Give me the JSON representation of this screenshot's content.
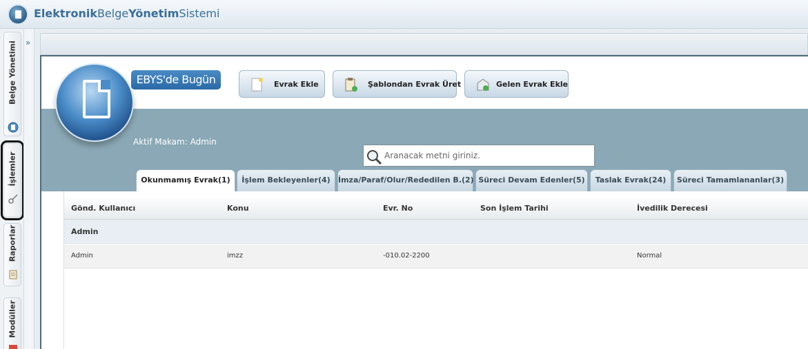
{
  "app": {
    "title_part1": "Elektronik",
    "title_part2": "Belge",
    "title_part3": "Yönetim",
    "title_part4": "Sistemi"
  },
  "left_tabs": [
    {
      "label": "Belge Yönetimi",
      "icon": "document-icon"
    },
    {
      "label": "İşlemler",
      "icon": "key-icon"
    },
    {
      "label": "Raporlar",
      "icon": "report-icon"
    },
    {
      "label": "Modüller",
      "icon": "module-icon"
    }
  ],
  "hero": {
    "pill_label": "EBYS'de Bugün",
    "aktif_makam": "Aktif Makam: Admin"
  },
  "actions": [
    {
      "label": "Evrak Ekle",
      "icon": "new-document-icon"
    },
    {
      "label": "Şablondan Evrak Üret",
      "icon": "template-icon"
    },
    {
      "label": "Gelen Evrak Ekle",
      "icon": "incoming-mail-icon"
    }
  ],
  "search": {
    "placeholder": "Aranacak metni giriniz."
  },
  "tabs": [
    {
      "label": "Okunmamış Evrak(1)",
      "active": true
    },
    {
      "label": "İşlem Bekleyenler(4)",
      "active": false
    },
    {
      "label": "İmza/Paraf/Olur/Rededilen B.(2)",
      "active": false
    },
    {
      "label": "Süreci Devam Edenler(5)",
      "active": false
    },
    {
      "label": "Taslak Evrak(24)",
      "active": false
    },
    {
      "label": "Süreci Tamamlananlar(3)",
      "active": false
    }
  ],
  "table": {
    "columns": [
      "Gönd. Kullanıcı",
      "Konu",
      "Evr. No",
      "Son İşlem Tarihi",
      "İvedilik Derecesi"
    ],
    "group": "Admin",
    "rows": [
      [
        "Admin",
        "imzz",
        "-010.02-2200",
        "",
        "Normal"
      ]
    ]
  },
  "colors": {
    "accent": "#3a6e9a",
    "band": "#8aa8b5",
    "pill": "#2a6aa8"
  }
}
